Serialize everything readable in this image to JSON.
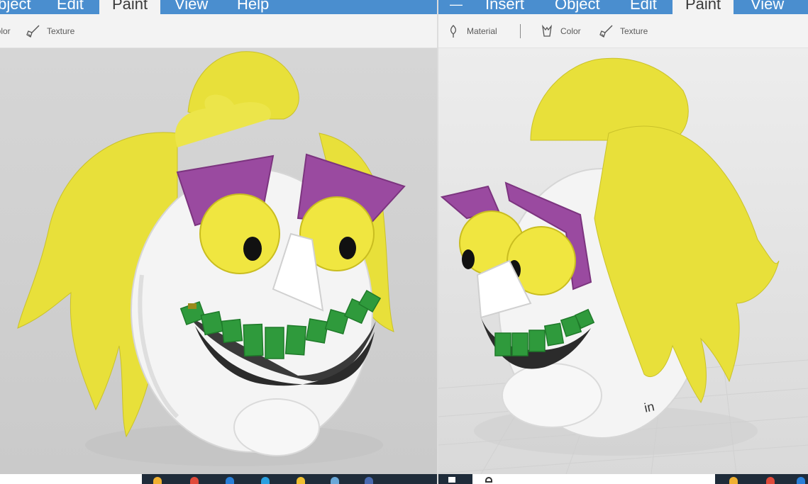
{
  "left_window": {
    "menu": [
      {
        "label": "Object",
        "active": false
      },
      {
        "label": "Edit",
        "active": false
      },
      {
        "label": "Paint",
        "active": true
      },
      {
        "label": "View",
        "active": false
      },
      {
        "label": "Help",
        "active": false
      }
    ],
    "toolbar": [
      {
        "label": "Color",
        "icon": "color-icon"
      },
      {
        "label": "Texture",
        "icon": "texture-brush-icon"
      }
    ]
  },
  "right_window": {
    "menu": [
      {
        "label": "Insert",
        "active": false
      },
      {
        "label": "Object",
        "active": false
      },
      {
        "label": "Edit",
        "active": false
      },
      {
        "label": "Paint",
        "active": true
      },
      {
        "label": "View",
        "active": false
      }
    ],
    "toolbar": [
      {
        "label": "Material",
        "icon": "material-icon"
      },
      {
        "label": "Color",
        "icon": "color-icon"
      },
      {
        "label": "Texture",
        "icon": "texture-brush-icon"
      }
    ],
    "unit_label": "in"
  },
  "colors": {
    "menubar": "#4a8ecf",
    "toolbar": "#f3f3f3",
    "hair": "#e8e03a",
    "eyebrow": "#9a4aa0",
    "teeth": "#2f9a3c",
    "body": "#f4f4f4",
    "taskbar": "#1f2c3a"
  }
}
